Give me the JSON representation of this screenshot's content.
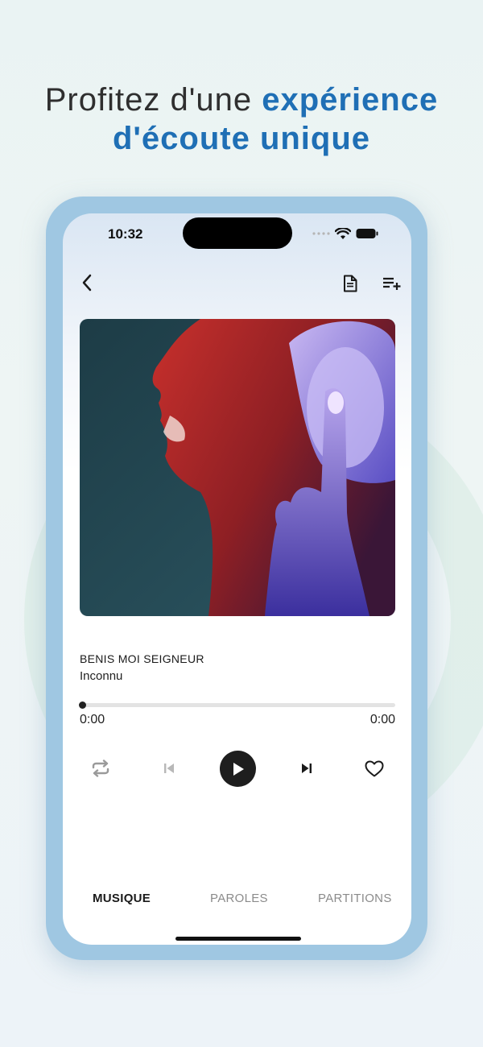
{
  "headline": {
    "line1_plain": "Profitez d'une ",
    "line1_accent": "expérience",
    "line2_accent": "d'écoute unique"
  },
  "status_bar": {
    "time": "10:32"
  },
  "top_bar": {
    "back_icon": "chevron-left-icon",
    "lyrics_icon": "document-icon",
    "queue_icon": "playlist-add-icon"
  },
  "track": {
    "title": "BENIS MOI SEIGNEUR",
    "artist": "Inconnu",
    "current_time": "0:00",
    "total_time": "0:00",
    "progress": 0
  },
  "controls": {
    "repeat_icon": "repeat-icon",
    "previous_icon": "skip-previous-icon",
    "play_icon": "play-icon",
    "next_icon": "skip-next-icon",
    "favorite_icon": "heart-outline-icon"
  },
  "tabs": [
    {
      "label": "MUSIQUE",
      "active": true
    },
    {
      "label": "PAROLES",
      "active": false
    },
    {
      "label": "PARTITIONS",
      "active": false
    }
  ],
  "colors": {
    "accent": "#1f6fb5",
    "frame": "#9fc7e2",
    "active_tab": "#1a1a1a",
    "inactive_tab": "#8b8b8b"
  }
}
